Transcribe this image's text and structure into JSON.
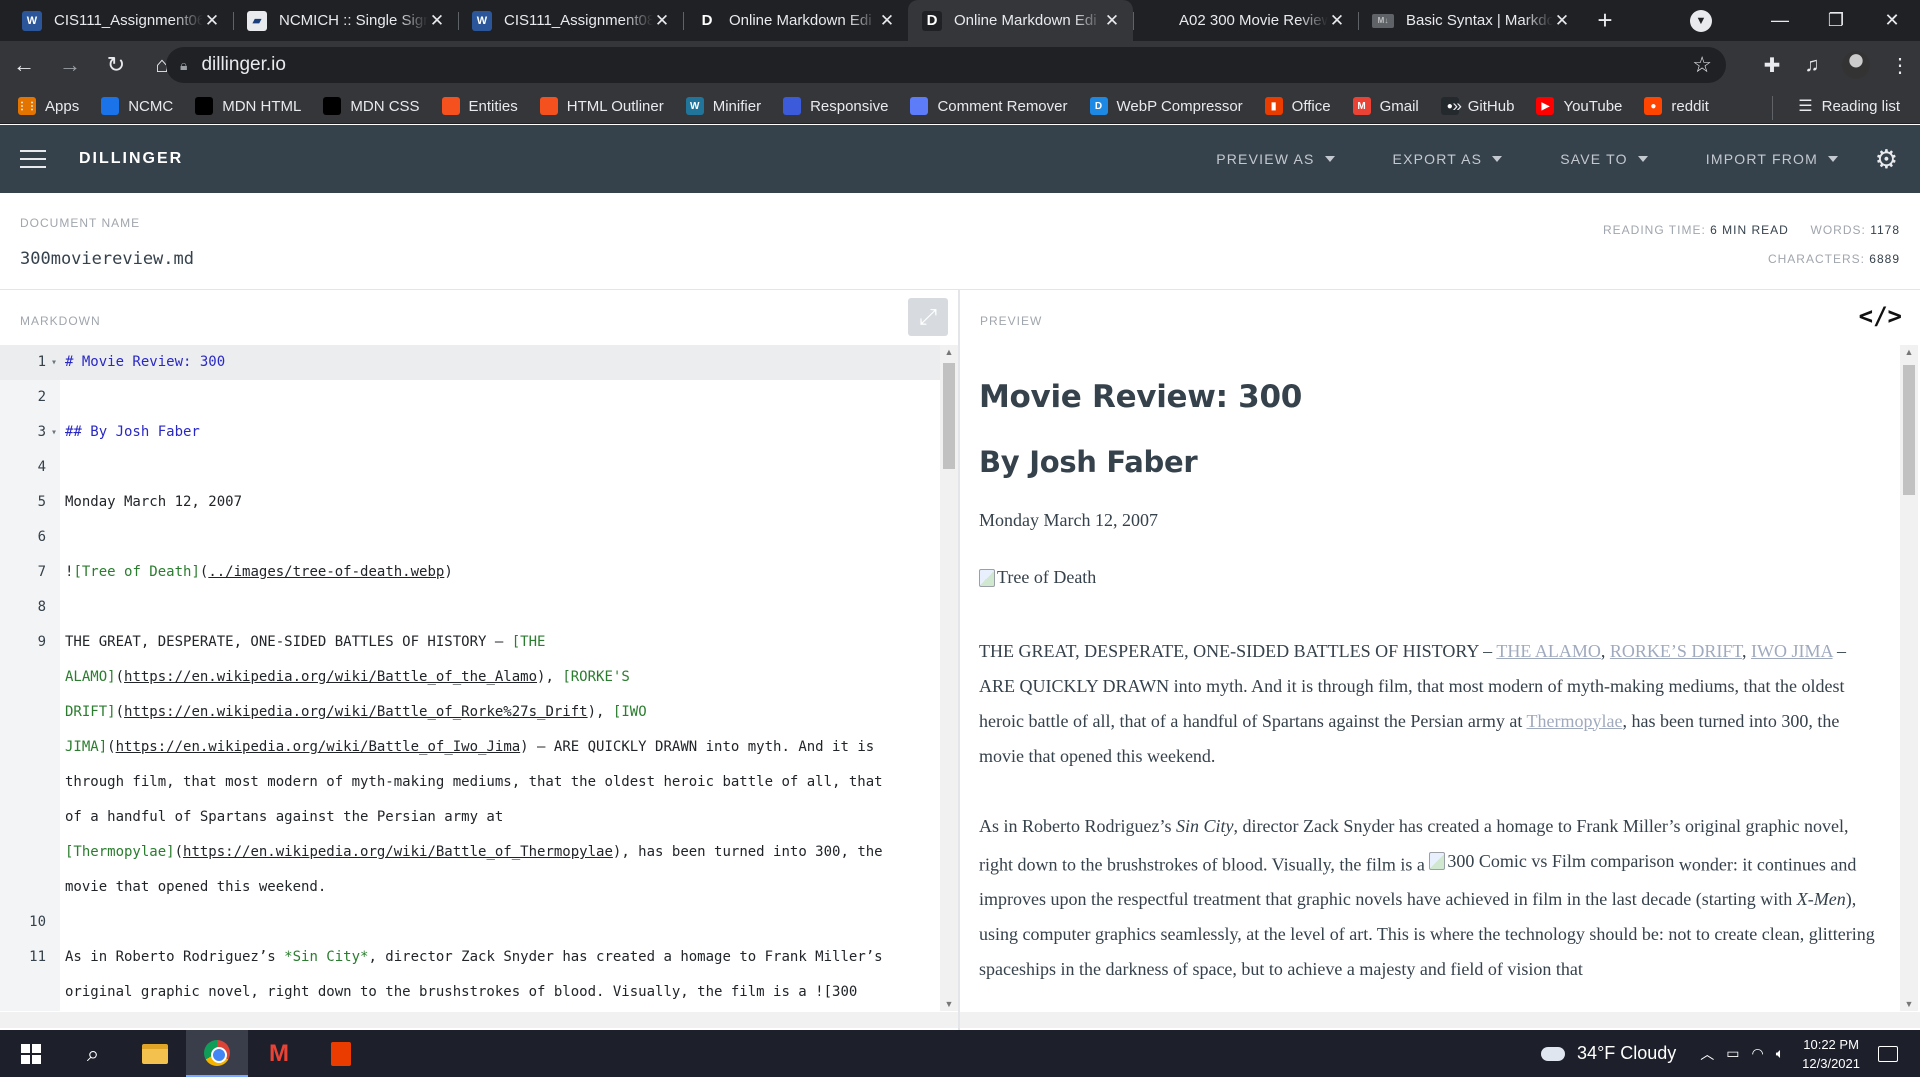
{
  "browser": {
    "tabs": [
      {
        "title": "CIS111_Assignment06",
        "favicon": "word"
      },
      {
        "title": "NCMICH :: Single Sign",
        "favicon": "sso"
      },
      {
        "title": "CIS111_Assignment08",
        "favicon": "word"
      },
      {
        "title": "Online Markdown Edi",
        "favicon": "dillinger"
      },
      {
        "title": "Online Markdown Edi",
        "favicon": "dillinger",
        "active": true
      },
      {
        "title": "A02 300 Movie Review",
        "favicon": "none"
      },
      {
        "title": "Basic Syntax | Markdo",
        "favicon": "markdown"
      }
    ],
    "new_tab_glyph": "+",
    "close_glyph": "✕",
    "url": "dillinger.io",
    "bookmarks": [
      {
        "label": "Apps",
        "icon": "apps-grid-icon",
        "color": "#e37400"
      },
      {
        "label": "NCMC",
        "icon": "ncmc-icon",
        "color": "#1a73e8"
      },
      {
        "label": "MDN HTML",
        "icon": "mdn-icon",
        "color": "#000000"
      },
      {
        "label": "MDN CSS",
        "icon": "mdn-icon",
        "color": "#000000"
      },
      {
        "label": "Entities",
        "icon": "entities-icon",
        "color": "#f4511e"
      },
      {
        "label": "HTML Outliner",
        "icon": "html-outliner-icon",
        "color": "#f4511e"
      },
      {
        "label": "Minifier",
        "icon": "wordpress-icon",
        "color": "#21759b"
      },
      {
        "label": "Responsive",
        "icon": "responsive-icon",
        "color": "#3b5bdb"
      },
      {
        "label": "Comment Remover",
        "icon": "cloud-icon",
        "color": "#5c7cfa"
      },
      {
        "label": "WebP Compressor",
        "icon": "webp-icon",
        "color": "#1e88e5"
      },
      {
        "label": "Office",
        "icon": "office-icon",
        "color": "#eb3c00"
      },
      {
        "label": "Gmail",
        "icon": "gmail-icon",
        "color": "#ea4335"
      },
      {
        "label": "GitHub",
        "icon": "github-icon",
        "color": "#24292e"
      },
      {
        "label": "YouTube",
        "icon": "youtube-icon",
        "color": "#ff0000"
      },
      {
        "label": "reddit",
        "icon": "reddit-icon",
        "color": "#ff4500"
      }
    ],
    "bookmarks_more": "»",
    "reading_list": "Reading list"
  },
  "app": {
    "brand": "DILLINGER",
    "menu": [
      "PREVIEW AS",
      "EXPORT AS",
      "SAVE TO",
      "IMPORT FROM"
    ],
    "document_name_label": "DOCUMENT NAME",
    "document_name": "300moviereview.md",
    "stats": {
      "reading_time_label": "READING TIME:",
      "reading_time": "6 MIN READ",
      "words_label": "WORDS:",
      "words": "1178",
      "characters_label": "CHARACTERS:",
      "characters": "6889"
    },
    "markdown_label": "MARKDOWN",
    "preview_label": "PREVIEW",
    "code_toggle_glyph": "</>"
  },
  "editor": {
    "lines": [
      {
        "n": "1",
        "fold": true,
        "active": true,
        "segs": [
          {
            "t": "# Movie Review: 300",
            "c": "h"
          }
        ]
      },
      {
        "n": "2",
        "segs": []
      },
      {
        "n": "3",
        "fold": true,
        "segs": [
          {
            "t": "## By Josh Faber",
            "c": "h"
          }
        ]
      },
      {
        "n": "4",
        "segs": []
      },
      {
        "n": "5",
        "segs": [
          {
            "t": "Monday March 12, 2007"
          }
        ]
      },
      {
        "n": "6",
        "segs": []
      },
      {
        "n": "7",
        "segs": [
          {
            "t": "!"
          },
          {
            "t": "[Tree of Death]",
            "c": "g"
          },
          {
            "t": "("
          },
          {
            "t": "../images/tree-of-death.webp",
            "c": "u"
          },
          {
            "t": ")"
          }
        ]
      },
      {
        "n": "8",
        "segs": []
      },
      {
        "n": "9",
        "segs": [
          {
            "t": "THE GREAT, DESPERATE, ONE-SIDED BATTLES OF HISTORY – "
          },
          {
            "t": "[THE",
            "c": "g"
          }
        ]
      },
      {
        "n": "",
        "segs": [
          {
            "t": "ALAMO]",
            "c": "g"
          },
          {
            "t": "("
          },
          {
            "t": "https://en.wikipedia.org/wiki/Battle_of_the_Alamo",
            "c": "u"
          },
          {
            "t": "), "
          },
          {
            "t": "[RORKE'S",
            "c": "g"
          }
        ]
      },
      {
        "n": "",
        "segs": [
          {
            "t": "DRIFT]",
            "c": "g"
          },
          {
            "t": "("
          },
          {
            "t": "https://en.wikipedia.org/wiki/Battle_of_Rorke%27s_Drift",
            "c": "u"
          },
          {
            "t": "), "
          },
          {
            "t": "[IWO",
            "c": "g"
          }
        ]
      },
      {
        "n": "",
        "segs": [
          {
            "t": "JIMA]",
            "c": "g"
          },
          {
            "t": "("
          },
          {
            "t": "https://en.wikipedia.org/wiki/Battle_of_Iwo_Jima",
            "c": "u"
          },
          {
            "t": ") – ARE QUICKLY DRAWN into myth. And it is"
          }
        ]
      },
      {
        "n": "",
        "segs": [
          {
            "t": "through film, that most modern of myth-making mediums, that the oldest heroic battle of all, that"
          }
        ]
      },
      {
        "n": "",
        "segs": [
          {
            "t": "of a handful of Spartans against the Persian army at"
          }
        ]
      },
      {
        "n": "",
        "segs": [
          {
            "t": "[Thermopylae]",
            "c": "g"
          },
          {
            "t": "("
          },
          {
            "t": "https://en.wikipedia.org/wiki/Battle_of_Thermopylae",
            "c": "u"
          },
          {
            "t": "), has been turned into 300, the"
          }
        ]
      },
      {
        "n": "",
        "segs": [
          {
            "t": "movie that opened this weekend."
          }
        ]
      },
      {
        "n": "10",
        "segs": []
      },
      {
        "n": "11",
        "segs": [
          {
            "t": "As in Roberto Rodriguez’s "
          },
          {
            "t": "*Sin City*",
            "c": "g"
          },
          {
            "t": ", director Zack Snyder has created a homage to Frank Miller’s"
          }
        ]
      },
      {
        "n": "",
        "segs": [
          {
            "t": "original graphic novel, right down to the brushstrokes of blood. Visually, the film is a ![300"
          }
        ]
      }
    ]
  },
  "preview": {
    "h1": "Movie Review: 300",
    "h2": "By Josh Faber",
    "date": "Monday March 12, 2007",
    "img_alt": "Tree of Death",
    "p1": [
      {
        "t": "THE GREAT, DESPERATE, ONE-SIDED BATTLES OF HISTORY – "
      },
      {
        "t": "THE ALAMO",
        "link": true
      },
      {
        "t": ", "
      },
      {
        "t": "RORKE’S DRIFT",
        "link": true
      },
      {
        "t": ", "
      },
      {
        "t": "IWO JIMA",
        "link": true
      },
      {
        "t": " – ARE QUICKLY DRAWN into myth. And it is through film, that most modern of myth-making mediums, that the oldest heroic battle of all, that of a handful of Spartans against the Persian army at "
      },
      {
        "t": "Thermopylae",
        "link": true
      },
      {
        "t": ", has been turned into 300, the movie that opened this weekend."
      }
    ],
    "p2": [
      {
        "t": "As in Roberto Rodriguez’s "
      },
      {
        "t": "Sin City",
        "em": true
      },
      {
        "t": ", director Zack Snyder has created a homage to Frank Miller’s original graphic novel, right down to the brushstrokes of blood. Visually, the film is a "
      },
      {
        "t": "300 Comic vs Film comparison",
        "img": true
      },
      {
        "t": " wonder: it continues and improves upon the respectful treatment that graphic novels have achieved in film in the last decade (starting with "
      },
      {
        "t": "X-Men",
        "em": true
      },
      {
        "t": "), using computer graphics seamlessly, at the level of art. This is where the technology should be: not to create clean, glittering spaceships in the darkness of space, but to achieve a majesty and field of vision that"
      }
    ]
  },
  "taskbar": {
    "weather": "34°F  Cloudy",
    "time": "10:22 PM",
    "date": "12/3/2021"
  }
}
